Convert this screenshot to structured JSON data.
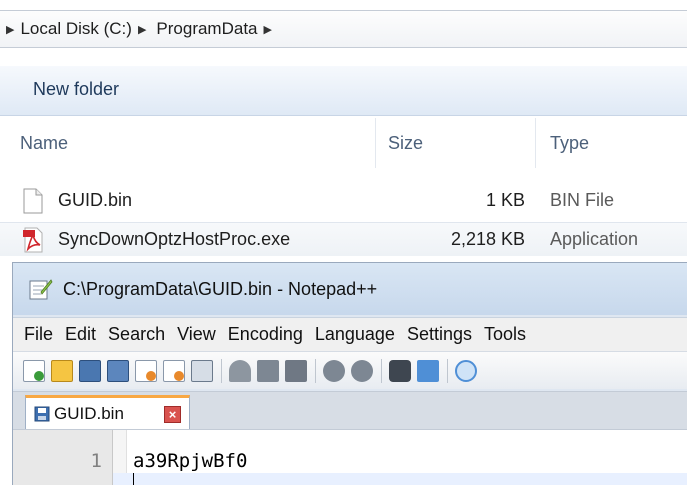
{
  "explorer": {
    "breadcrumb": {
      "items": [
        "Local Disk (C:)",
        "ProgramData"
      ]
    },
    "toolbar": {
      "new_folder_label": "New folder"
    },
    "columns": {
      "name": "Name",
      "size": "Size",
      "type": "Type"
    },
    "files": [
      {
        "name": "GUID.bin",
        "size": "1 KB",
        "type": "BIN File",
        "icon": "file-icon"
      },
      {
        "name": "SyncDownOptzHostProc.exe",
        "size": "2,218 KB",
        "type": "Application",
        "icon": "pdf-application-icon"
      }
    ]
  },
  "notepad": {
    "title": "C:\\ProgramData\\GUID.bin - Notepad++",
    "menu": [
      "File",
      "Edit",
      "Search",
      "View",
      "Encoding",
      "Language",
      "Settings",
      "Tools"
    ],
    "tab": {
      "label": "GUID.bin",
      "close_glyph": "×"
    },
    "editor": {
      "lines": [
        {
          "number": "1",
          "text": "a39RpjwBf0"
        }
      ]
    }
  },
  "colors": {
    "accent_tab": "#f8a844",
    "command_bar": "#dfe9f5",
    "close_button": "#d9534f"
  }
}
